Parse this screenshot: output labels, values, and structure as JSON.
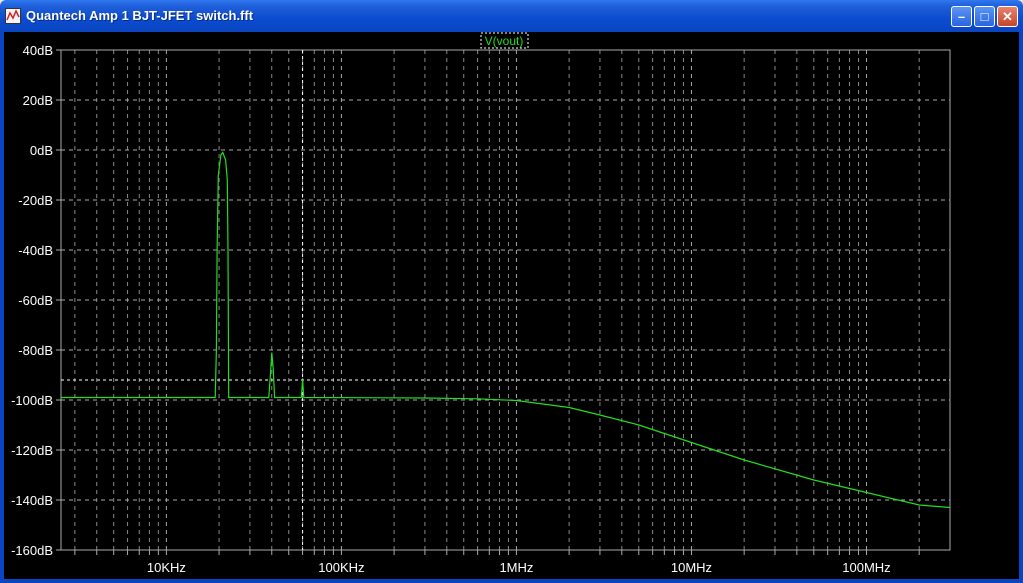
{
  "window": {
    "title": "Quantech Amp 1 BJT-JFET switch.fft",
    "minimize_label": "–",
    "maximize_label": "□",
    "close_label": "✕"
  },
  "plot": {
    "trace_label": "V(vout)",
    "trace_color": "#22dd22",
    "background": "#000000",
    "grid_color": "#aaaaaa"
  },
  "chart_data": {
    "type": "line",
    "title": "",
    "xlabel": "",
    "ylabel": "",
    "x_scale": "log",
    "xlim": [
      2500,
      300000000
    ],
    "ylim": [
      -160,
      40
    ],
    "y_ticks": [
      40,
      20,
      0,
      -20,
      -40,
      -60,
      -80,
      -100,
      -120,
      -140,
      -160
    ],
    "y_tick_labels": [
      "40dB",
      "20dB",
      "0dB",
      "-20dB",
      "-40dB",
      "-60dB",
      "-80dB",
      "-100dB",
      "-120dB",
      "-140dB",
      "-160dB"
    ],
    "x_ticks": [
      10000,
      100000,
      1000000,
      10000000,
      100000000
    ],
    "x_tick_labels": [
      "10KHz",
      "100KHz",
      "1MHz",
      "10MHz",
      "100MHz"
    ],
    "grid": true,
    "cursor_x": 60000,
    "cursor_y": -92,
    "series": [
      {
        "name": "V(vout)",
        "points": [
          [
            2500,
            -99
          ],
          [
            19000,
            -99
          ],
          [
            19300,
            -80
          ],
          [
            19500,
            -40
          ],
          [
            19800,
            -10
          ],
          [
            20500,
            -2
          ],
          [
            21000,
            -1
          ],
          [
            21800,
            -4
          ],
          [
            22300,
            -12
          ],
          [
            22500,
            -40
          ],
          [
            22700,
            -99
          ],
          [
            38500,
            -99
          ],
          [
            39300,
            -90
          ],
          [
            40000,
            -81
          ],
          [
            40800,
            -88
          ],
          [
            41500,
            -99
          ],
          [
            59000,
            -99
          ],
          [
            60000,
            -92
          ],
          [
            61000,
            -99
          ],
          [
            300000,
            -99.2
          ],
          [
            600000,
            -99.5
          ],
          [
            1000000,
            -100.2
          ],
          [
            2000000,
            -103
          ],
          [
            3000000,
            -106
          ],
          [
            5000000,
            -110
          ],
          [
            10000000,
            -117
          ],
          [
            20000000,
            -124
          ],
          [
            50000000,
            -132
          ],
          [
            100000000,
            -137
          ],
          [
            200000000,
            -142
          ],
          [
            300000000,
            -143
          ]
        ]
      }
    ]
  }
}
